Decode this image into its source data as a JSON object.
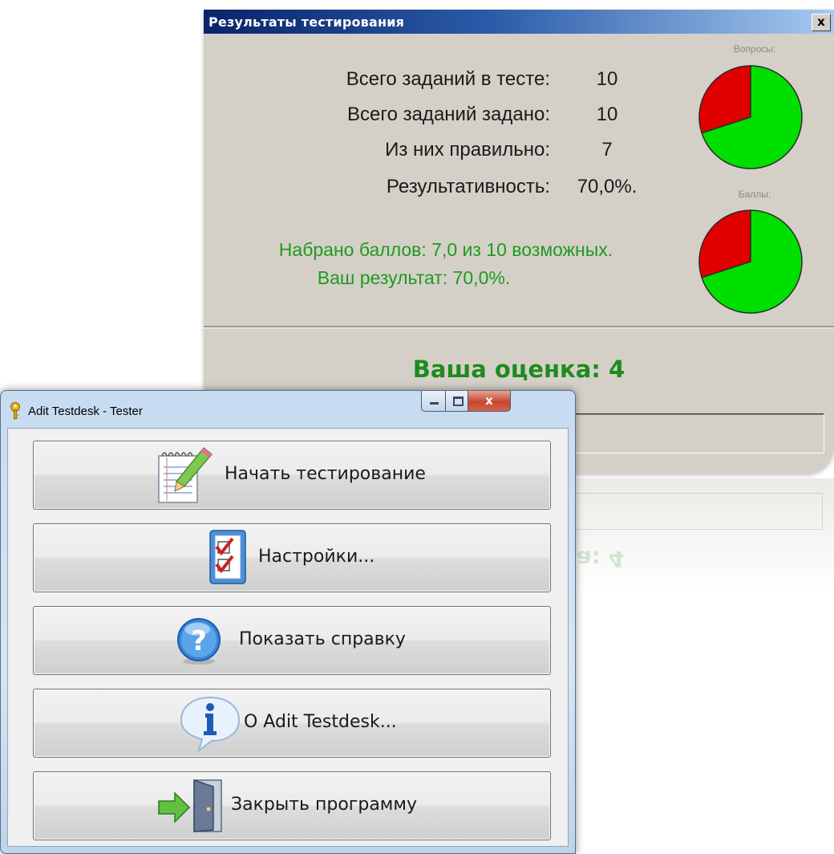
{
  "results_window": {
    "title": "Результаты тестирования",
    "close_glyph": "x",
    "stats": [
      {
        "label": "Всего заданий в тесте:",
        "value": "10"
      },
      {
        "label": "Всего заданий задано:",
        "value": "10"
      },
      {
        "label": "Из них правильно:",
        "value": "7"
      },
      {
        "label": "Результативность:",
        "value": "70,0%."
      }
    ],
    "points_line": "Набрано баллов: 7,0 из 10 возможных.",
    "result_line": "Ваш результат: 70,0%.",
    "pie_questions": {
      "caption": "Вопросы:",
      "correct_fraction": 0.7
    },
    "pie_points": {
      "caption": "Баллы:",
      "correct_fraction": 0.7
    },
    "grade": "Ваша оценка: 4",
    "reflection_text": "ка: 4",
    "colors": {
      "correct": "#00e000",
      "wrong": "#e00000",
      "green_text": "#1f9a1f"
    }
  },
  "tester_window": {
    "title": "Adit Testdesk - Tester",
    "close_glyph": "x",
    "buttons": [
      {
        "label": "Начать тестирование",
        "icon": "notepad-pencil-icon"
      },
      {
        "label": "Настройки...",
        "icon": "checklist-icon"
      },
      {
        "label": "Показать справку",
        "icon": "help-question-icon"
      },
      {
        "label": "О Adit Testdesk...",
        "icon": "info-bubble-icon"
      },
      {
        "label": "Закрыть программу",
        "icon": "exit-door-icon"
      }
    ]
  }
}
